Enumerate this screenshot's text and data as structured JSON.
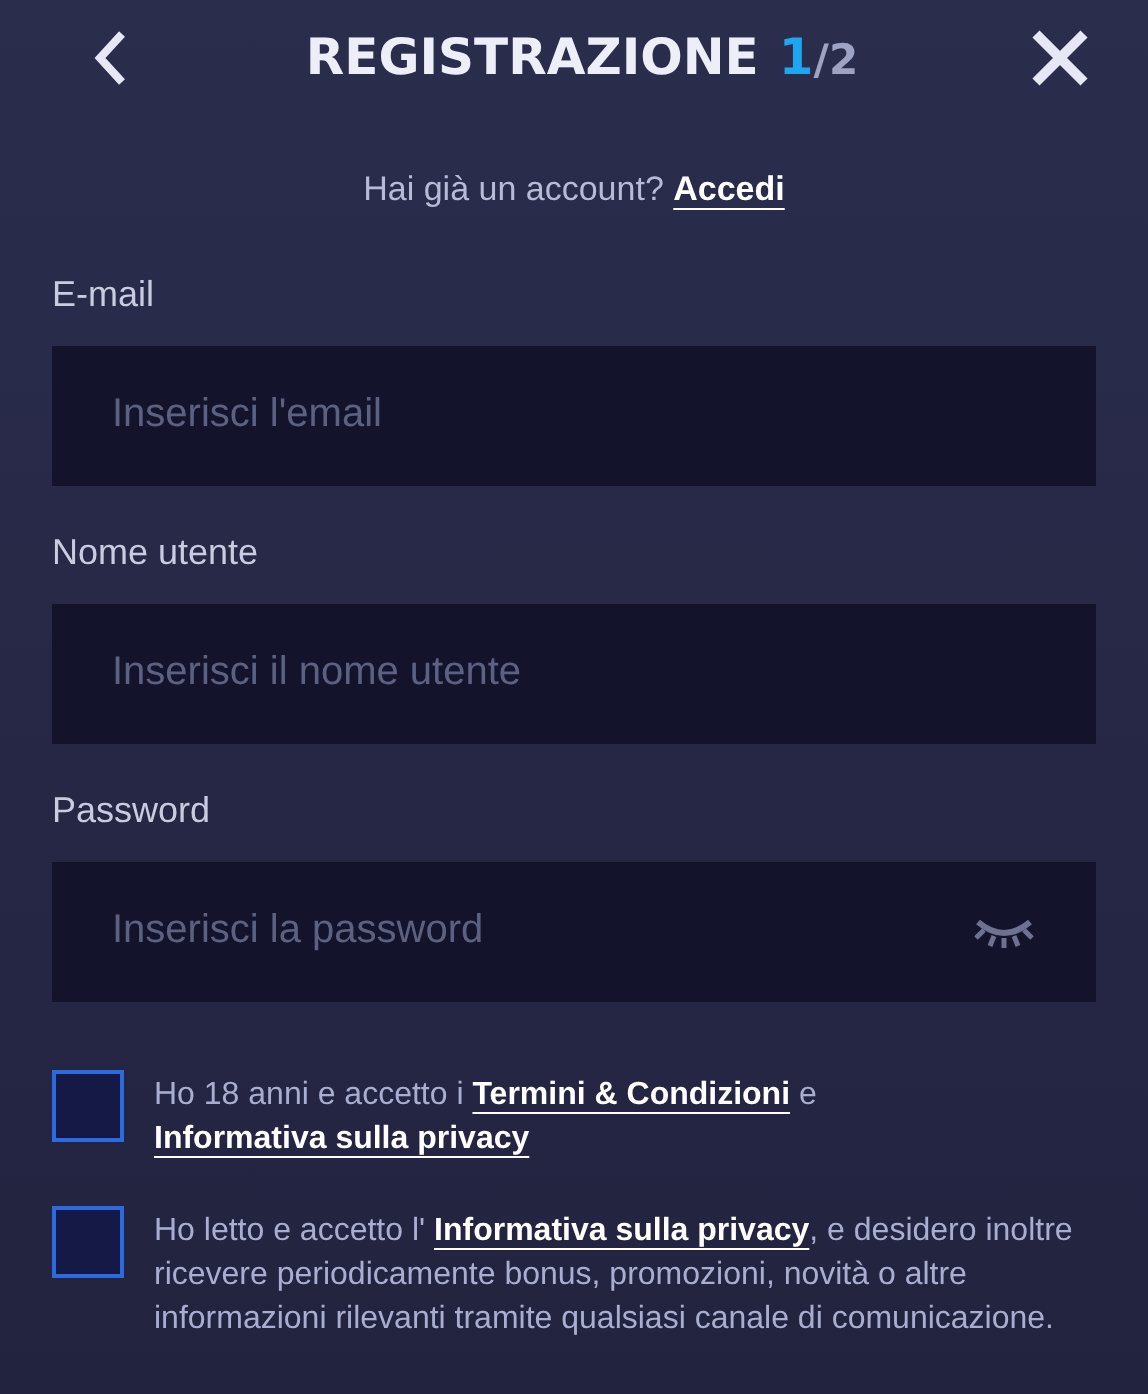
{
  "header": {
    "title": "REGISTRAZIONE",
    "step": "1",
    "total": "/2"
  },
  "login_prompt": {
    "text": "Hai già un account? ",
    "link": "Accedi"
  },
  "fields": [
    {
      "label": "E-mail",
      "placeholder": "Inserisci l'email",
      "kind": "text"
    },
    {
      "label": "Nome utente",
      "placeholder": "Inserisci il nome utente",
      "kind": "text"
    },
    {
      "label": "Password",
      "placeholder": "Inserisci la password",
      "kind": "password"
    }
  ],
  "consents": [
    {
      "checked": false,
      "parts": [
        {
          "text": "Ho 18 anni e accetto i ",
          "kind": "text"
        },
        {
          "text": "Termini & Condizioni",
          "kind": "link"
        },
        {
          "text": " e ",
          "kind": "text"
        },
        {
          "text": "Informativa sulla privacy",
          "kind": "link"
        }
      ]
    },
    {
      "checked": false,
      "parts": [
        {
          "text": "Ho letto e accetto l' ",
          "kind": "text"
        },
        {
          "text": "Informativa sulla privacy",
          "kind": "link"
        },
        {
          "text": ", e desidero inoltre ricevere periodicamente bonus, promozioni, novità o altre informazioni rilevanti tramite qualsiasi canale di comunicazione.",
          "kind": "text"
        }
      ]
    }
  ]
}
